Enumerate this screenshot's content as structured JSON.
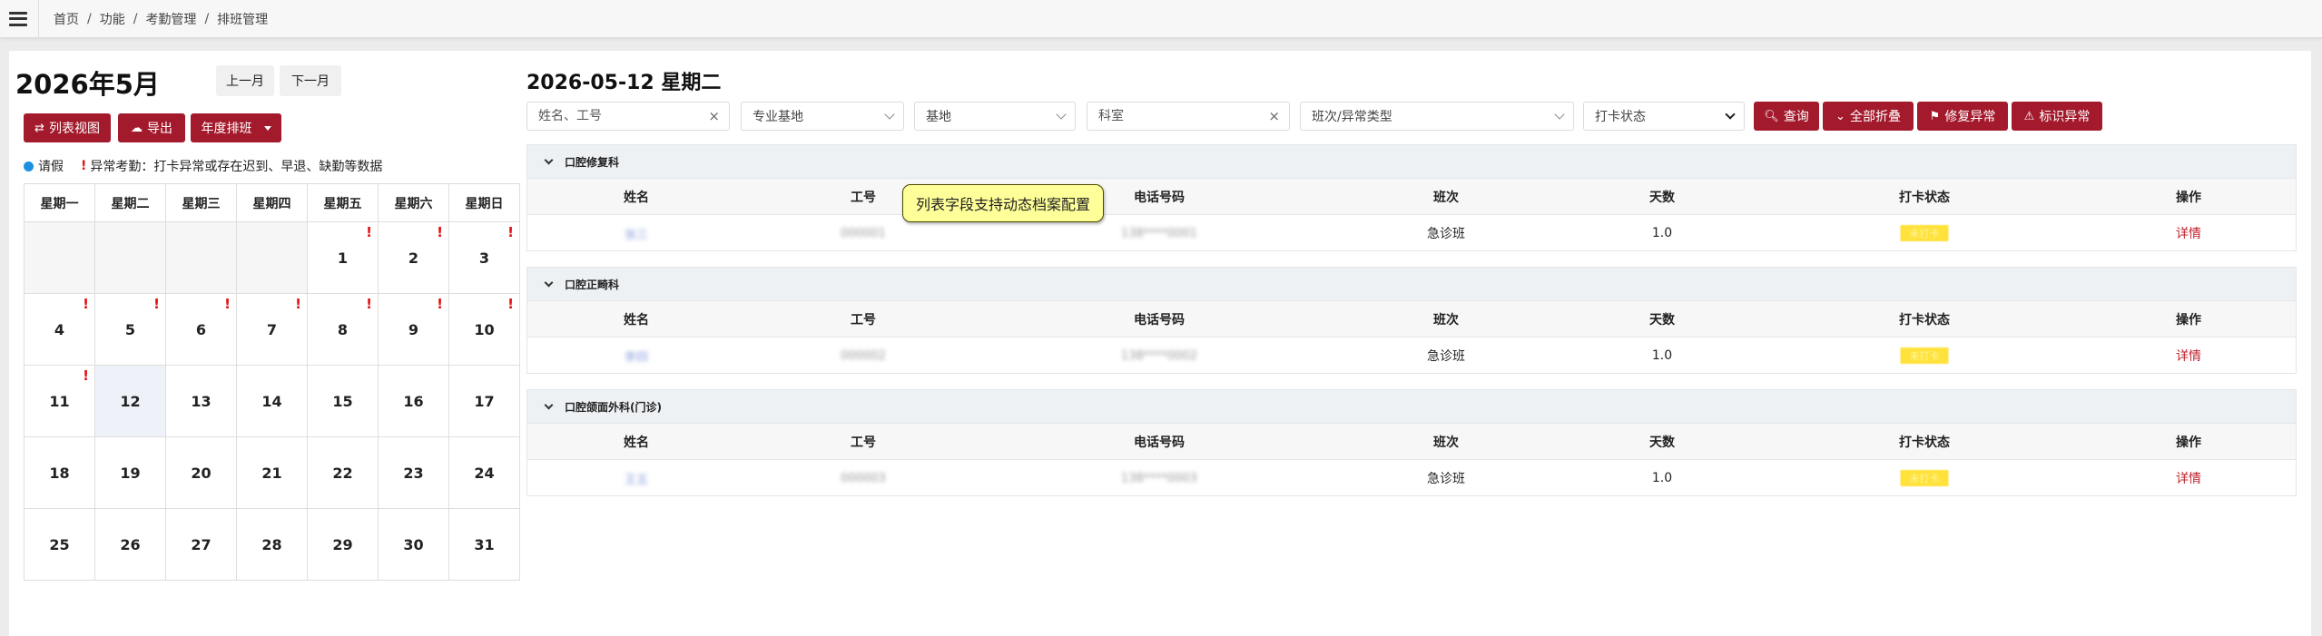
{
  "breadcrumb": [
    "首页",
    "功能",
    "考勤管理",
    "排班管理"
  ],
  "calendar": {
    "title": "2026年5月",
    "prev_label": "上一月",
    "next_label": "下一月",
    "list_view_label": "列表视图",
    "export_label": "导出",
    "yearly_label": "年度排班",
    "legend_leave": "请假",
    "legend_abnormal": "异常考勤：打卡异常或存在迟到、早退、缺勤等数据",
    "weekdays": [
      "星期一",
      "星期二",
      "星期三",
      "星期四",
      "星期五",
      "星期六",
      "星期日"
    ],
    "weeks": [
      [
        {
          "day": ""
        },
        {
          "day": ""
        },
        {
          "day": ""
        },
        {
          "day": ""
        },
        {
          "day": "1",
          "flag": "!"
        },
        {
          "day": "2",
          "flag": "!"
        },
        {
          "day": "3",
          "flag": "!"
        }
      ],
      [
        {
          "day": "4",
          "flag": "!"
        },
        {
          "day": "5",
          "flag": "!"
        },
        {
          "day": "6",
          "flag": "!"
        },
        {
          "day": "7",
          "flag": "!"
        },
        {
          "day": "8",
          "flag": "!"
        },
        {
          "day": "9",
          "flag": "!"
        },
        {
          "day": "10",
          "flag": "!"
        }
      ],
      [
        {
          "day": "11",
          "flag": "!"
        },
        {
          "day": "12",
          "today": true
        },
        {
          "day": "13"
        },
        {
          "day": "14"
        },
        {
          "day": "15"
        },
        {
          "day": "16"
        },
        {
          "day": "17"
        }
      ],
      [
        {
          "day": "18"
        },
        {
          "day": "19"
        },
        {
          "day": "20"
        },
        {
          "day": "21"
        },
        {
          "day": "22"
        },
        {
          "day": "23"
        },
        {
          "day": "24"
        }
      ],
      [
        {
          "day": "25"
        },
        {
          "day": "26"
        },
        {
          "day": "27"
        },
        {
          "day": "28"
        },
        {
          "day": "29"
        },
        {
          "day": "30"
        },
        {
          "day": "31"
        }
      ]
    ]
  },
  "detail": {
    "date_title": "2026-05-12 星期二",
    "filters": {
      "name_placeholder": "姓名、工号",
      "major_base": "专业基地",
      "base": "基地",
      "dept_placeholder": "科室",
      "shift_type": "班次/异常类型",
      "clock_status": "打卡状态"
    },
    "buttons": {
      "query": "查询",
      "collapse_all": "全部折叠",
      "fix_abnormal": "修复异常",
      "mark_abnormal": "标识异常"
    },
    "columns": [
      "姓名",
      "工号",
      "电话号码",
      "班次",
      "天数",
      "打卡状态",
      "操作"
    ],
    "tooltip": "列表字段支持动态档案配置",
    "sections": [
      {
        "name": "口腔修复科",
        "rows": [
          {
            "name": "张三",
            "id": "000001",
            "phone": "138****0001",
            "shift": "急诊班",
            "days": "1.0",
            "status": "未打卡",
            "action": "详情"
          }
        ]
      },
      {
        "name": "口腔正畸科",
        "rows": [
          {
            "name": "李四",
            "id": "000002",
            "phone": "138****0002",
            "shift": "急诊班",
            "days": "1.0",
            "status": "未打卡",
            "action": "详情"
          }
        ]
      },
      {
        "name": "口腔颌面外科(门诊)",
        "rows": [
          {
            "name": "王五",
            "id": "000003",
            "phone": "138****0003",
            "shift": "急诊班",
            "days": "1.0",
            "status": "未打卡",
            "action": "详情"
          }
        ]
      }
    ]
  },
  "colors": {
    "accent": "#a31a2c",
    "leave_dot": "#1e90e0",
    "abnormal": "#e01010",
    "status_badge": "#ffe23b"
  }
}
